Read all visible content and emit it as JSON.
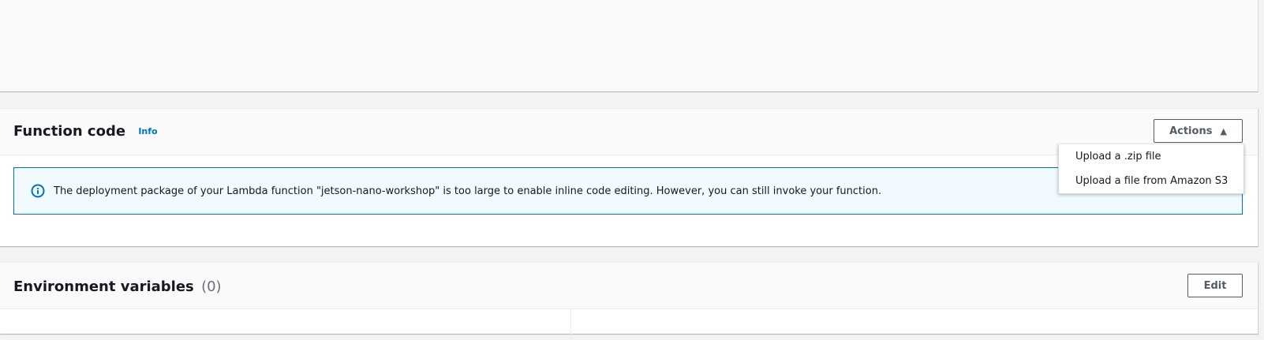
{
  "function_code": {
    "title": "Function code",
    "info_label": "Info",
    "actions_label": "Actions",
    "caret_icon": "caret-up-icon",
    "dropdown_items": [
      "Upload a .zip file",
      "Upload a file from Amazon S3"
    ],
    "alert_message": "The deployment package of your Lambda function \"jetson-nano-workshop\" is too large to enable inline code editing. However, you can still invoke your function.",
    "alert_icon": "info-circle-icon"
  },
  "env_vars": {
    "title": "Environment variables",
    "count": "(0)",
    "edit_label": "Edit"
  },
  "colors": {
    "accent": "#0073bb",
    "alert_bg": "#f1faff",
    "text": "#16191f",
    "button_border": "#545b64"
  }
}
